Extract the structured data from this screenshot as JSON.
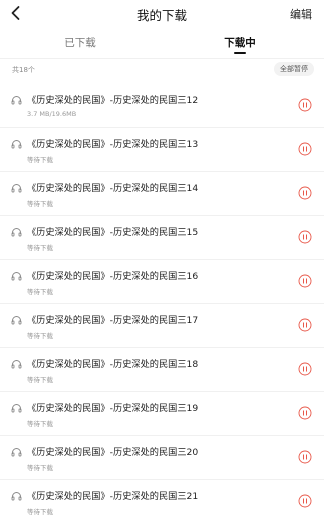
{
  "header": {
    "title": "我的下载",
    "edit_label": "编辑",
    "back_icon": "chevron-left-icon"
  },
  "tabs": [
    {
      "label": "已下载",
      "active": false
    },
    {
      "label": "下载中",
      "active": true
    }
  ],
  "summary": {
    "count_label": "共18个",
    "pause_all_label": "全部暂停"
  },
  "colors": {
    "accent": "#e8584a",
    "text_primary": "#222222",
    "text_secondary": "#999999"
  },
  "items": [
    {
      "title": "《历史深处的民国》-历史深处的民国三12",
      "status": "3.7 MB/19.6MB",
      "icon": "headphones-icon",
      "action_icon": "pause-circle-icon"
    },
    {
      "title": "《历史深处的民国》-历史深处的民国三13",
      "status": "等待下载",
      "icon": "headphones-icon",
      "action_icon": "pause-circle-icon"
    },
    {
      "title": "《历史深处的民国》-历史深处的民国三14",
      "status": "等待下载",
      "icon": "headphones-icon",
      "action_icon": "pause-circle-icon"
    },
    {
      "title": "《历史深处的民国》-历史深处的民国三15",
      "status": "等待下载",
      "icon": "headphones-icon",
      "action_icon": "pause-circle-icon"
    },
    {
      "title": "《历史深处的民国》-历史深处的民国三16",
      "status": "等待下载",
      "icon": "headphones-icon",
      "action_icon": "pause-circle-icon"
    },
    {
      "title": "《历史深处的民国》-历史深处的民国三17",
      "status": "等待下载",
      "icon": "headphones-icon",
      "action_icon": "pause-circle-icon"
    },
    {
      "title": "《历史深处的民国》-历史深处的民国三18",
      "status": "等待下载",
      "icon": "headphones-icon",
      "action_icon": "pause-circle-icon"
    },
    {
      "title": "《历史深处的民国》-历史深处的民国三19",
      "status": "等待下载",
      "icon": "headphones-icon",
      "action_icon": "pause-circle-icon"
    },
    {
      "title": "《历史深处的民国》-历史深处的民国三20",
      "status": "等待下载",
      "icon": "headphones-icon",
      "action_icon": "pause-circle-icon"
    },
    {
      "title": "《历史深处的民国》-历史深处的民国三21",
      "status": "等待下载",
      "icon": "headphones-icon",
      "action_icon": "pause-circle-icon"
    }
  ]
}
